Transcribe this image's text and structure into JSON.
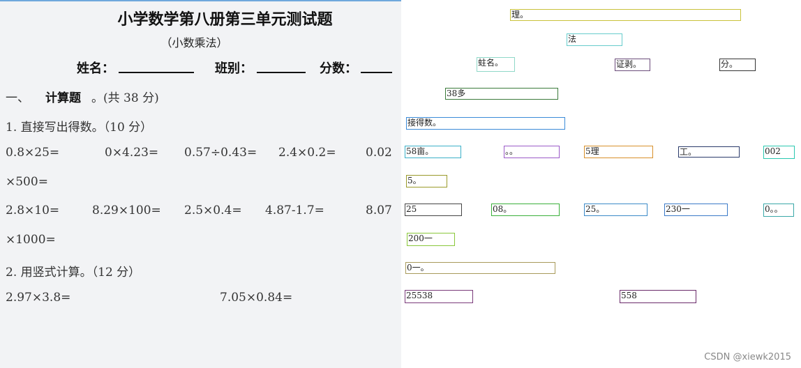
{
  "worksheet": {
    "title": "小学数学第八册第三单元测试题",
    "subtitle": "（小数乘法）",
    "name_label": "姓名：",
    "class_label": "班别：",
    "score_label": "分数：",
    "section1": {
      "number": "一、",
      "heading": "计算题",
      "points": "。(共 38 分)"
    },
    "q1_title": "1. 直接写出得数。（10 分）",
    "q1_row1": [
      "0.8×25=",
      "0×4.23=",
      "0.57÷0.43=",
      "2.4×0.2=",
      "0.02"
    ],
    "q1_row1_cont": "×500=",
    "q1_row2": [
      "2.8×10=",
      "8.29×100=",
      "2.5×0.4=",
      "4.87-1.7=",
      "8.07"
    ],
    "q1_row2_cont": "×1000=",
    "q2_title": "2. 用竖式计算。（12 分）",
    "q2_row": [
      "2.97×3.8=",
      "7.05×0.84="
    ]
  },
  "ocr_results": [
    {
      "text": "理。",
      "color": "#c9c23a"
    },
    {
      "text": "法",
      "color": "#66cccc"
    },
    {
      "text": "蛀名。",
      "color": "#8fd8c8"
    },
    {
      "text": "证剥。",
      "color": "#6b4c7a"
    },
    {
      "text": "分。",
      "color": "#333333"
    },
    {
      "text": "38多",
      "color": "#3a7a3a"
    },
    {
      "text": "接得数。",
      "color": "#3a8ad8"
    },
    {
      "text": "58亩。",
      "color": "#3ab0c8"
    },
    {
      "text": "。。",
      "color": "#9a5ac8"
    },
    {
      "text": "5理",
      "color": "#d8902a"
    },
    {
      "text": "工。",
      "color": "#2a3a6a"
    },
    {
      "text": "002",
      "color": "#2ac8b0"
    },
    {
      "text": "5。",
      "color": "#9a9a2a"
    },
    {
      "text": "25",
      "color": "#444444"
    },
    {
      "text": "08。",
      "color": "#3ab03a"
    },
    {
      "text": "25。",
      "color": "#3a8ac8"
    },
    {
      "text": "230一",
      "color": "#3a7ac8"
    },
    {
      "text": "0。。",
      "color": "#3aa8a8"
    },
    {
      "text": "200一",
      "color": "#8ac83a"
    },
    {
      "text": "0一。",
      "color": "#a89a5a"
    },
    {
      "text": "25538",
      "color": "#7a3a7a"
    },
    {
      "text": "558",
      "color": "#6a2a6a"
    }
  ],
  "watermark": "CSDN @xiewk2015"
}
